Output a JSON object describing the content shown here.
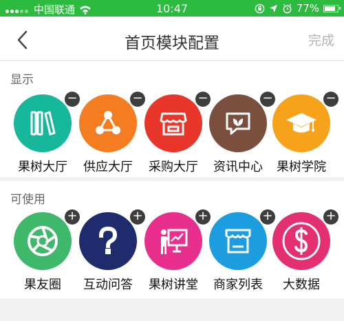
{
  "status_bar": {
    "carrier": "中国联通",
    "time": "10:47",
    "battery_percent": "77%",
    "battery_level": 0.77
  },
  "nav": {
    "title": "首页模块配置",
    "done_label": "完成"
  },
  "shown_section": {
    "title": "显示",
    "badge_symbol": "−",
    "modules": [
      {
        "label": "果树大厅",
        "color": "#17b79b",
        "icon": "books-icon"
      },
      {
        "label": "供应大厅",
        "color": "#f47d22",
        "icon": "network-icon"
      },
      {
        "label": "采购大厅",
        "color": "#e8362b",
        "icon": "storefront-icon"
      },
      {
        "label": "资讯中心",
        "color": "#7a4f3e",
        "icon": "leaf-chat-icon"
      },
      {
        "label": "果树学院",
        "color": "#f6a21b",
        "icon": "graduation-cap-icon"
      }
    ]
  },
  "available_section": {
    "title": "可使用",
    "badge_symbol": "+",
    "modules": [
      {
        "label": "果友圈",
        "color": "#3fb86b",
        "icon": "aperture-icon"
      },
      {
        "label": "互动问答",
        "color": "#1e2c6e",
        "icon": "question-icon"
      },
      {
        "label": "果树讲堂",
        "color": "#e82f8e",
        "icon": "lecture-icon"
      },
      {
        "label": "商家列表",
        "color": "#1c9de0",
        "icon": "shop-icon"
      },
      {
        "label": "大数据",
        "color": "#e42f72",
        "icon": "dollar-icon"
      }
    ]
  }
}
